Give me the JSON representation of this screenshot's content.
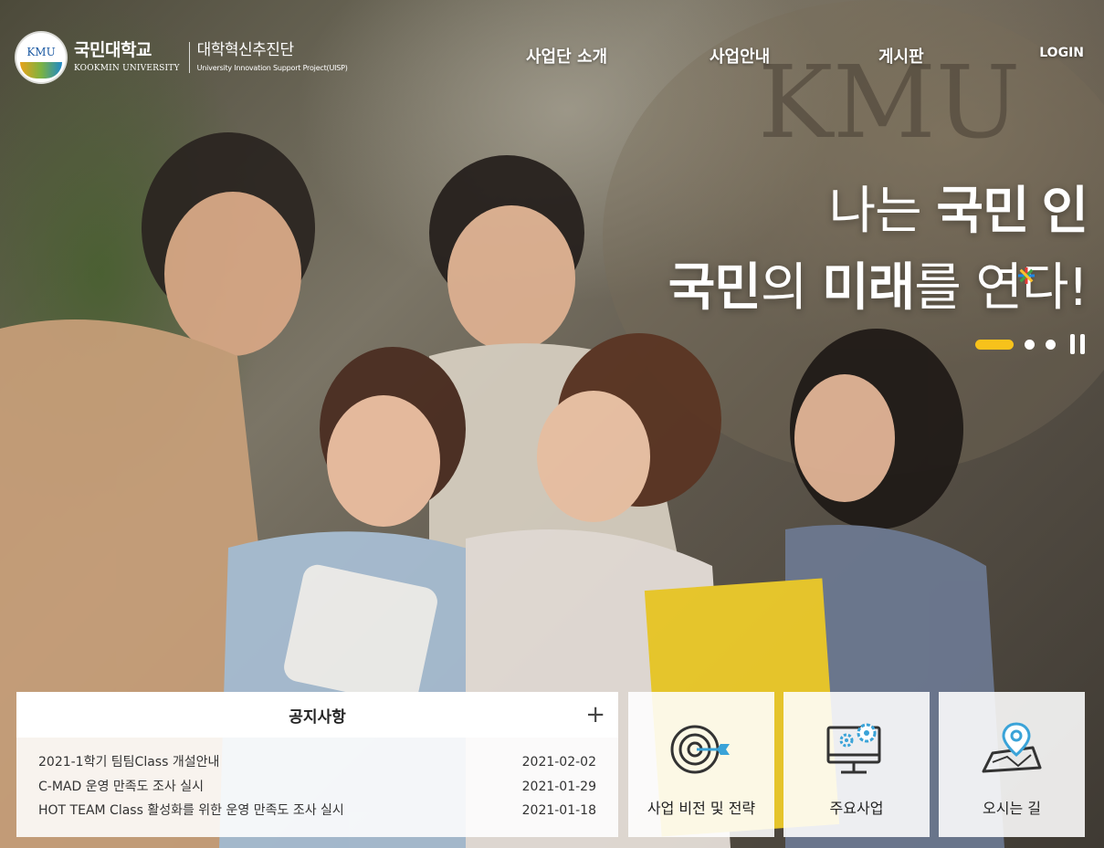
{
  "header": {
    "logo_seal": "KMU",
    "logo_name_ko": "국민대학교",
    "logo_name_en": "KOOKMIN UNIVERSITY",
    "logo_sub_ko": "대학혁신추진단",
    "logo_sub_en": "University Innovation Support Project(UISP)",
    "nav": [
      {
        "label": "사업단 소개"
      },
      {
        "label": "사업안내"
      },
      {
        "label": "게시판"
      }
    ],
    "login": "LOGIN"
  },
  "hero": {
    "line1_light": "나는 ",
    "line1_bold": "국민",
    "line1_end": "인",
    "line2_bold1": "국민",
    "line2_light1": "의 ",
    "line2_bold2": "미래",
    "line2_light2": "를 연다!",
    "slides_total": 3,
    "active_slide": 1,
    "accent_color": "#f7c21b"
  },
  "notice": {
    "title": "공지사항",
    "more": "+",
    "items": [
      {
        "title": "2021-1학기 팀팀Class 개설안내",
        "date": "2021-02-02"
      },
      {
        "title": "C-MAD 운영 만족도 조사 실시",
        "date": "2021-01-29"
      },
      {
        "title": "HOT TEAM Class 활성화를 위한 운영 만족도 조사 실시",
        "date": "2021-01-18"
      }
    ]
  },
  "quick_links": [
    {
      "label": "사업 비전 및 전략",
      "icon": "target-icon"
    },
    {
      "label": "주요사업",
      "icon": "monitor-gears-icon"
    },
    {
      "label": "오시는 길",
      "icon": "map-pin-icon"
    }
  ],
  "colors": {
    "icon_accent": "#3aa3d8",
    "icon_stroke": "#333333"
  }
}
